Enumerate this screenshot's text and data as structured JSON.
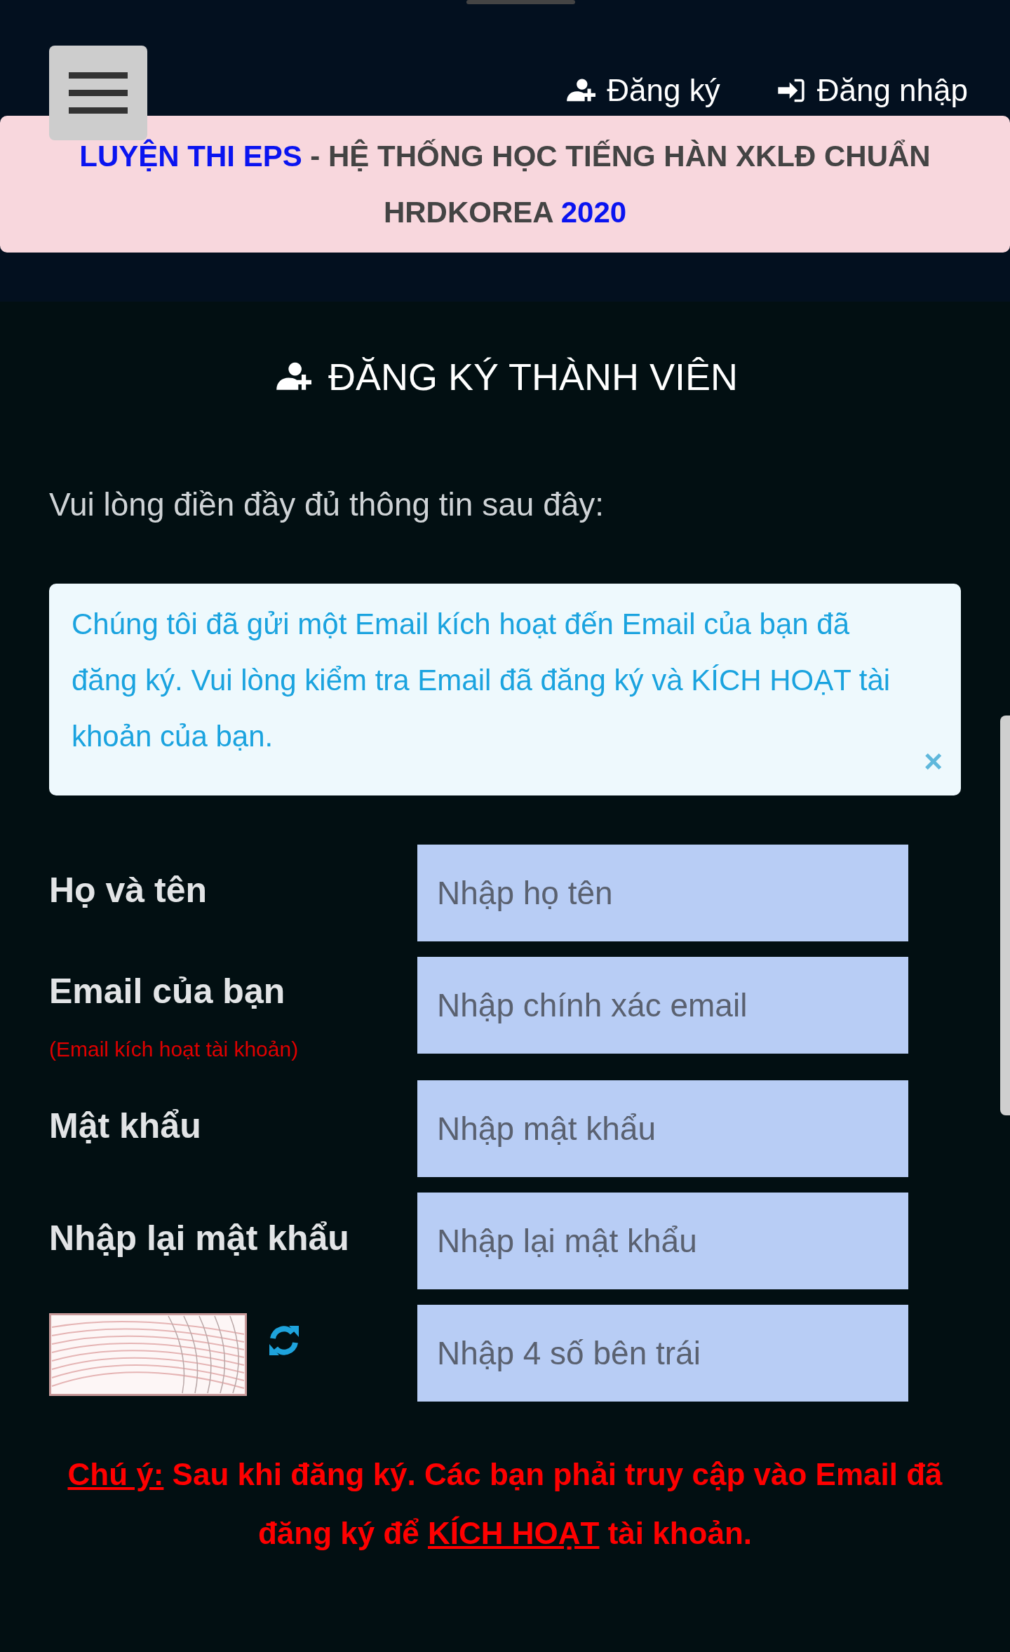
{
  "navbar": {
    "links": [
      {
        "label": "Đăng ký",
        "kind": "register"
      },
      {
        "label": "Đăng nhập",
        "kind": "login"
      }
    ]
  },
  "banner": {
    "parts": [
      {
        "text": "LUYỆN THI EPS",
        "highlight": true
      },
      {
        "text": " - HỆ THỐNG HỌC TIẾNG HÀN XKLĐ CHUẨN HRDKOREA ",
        "highlight": false
      },
      {
        "text": "2020",
        "highlight": true
      }
    ]
  },
  "form": {
    "title": "ĐĂNG KÝ THÀNH VIÊN",
    "subtitle": "Vui lòng điền đầy đủ thông tin sau đây:",
    "alert": {
      "text": "Chúng tôi đã gửi một Email kích hoạt đến Email của bạn đã đăng ký. Vui lòng kiểm tra Email đã đăng ký và KÍCH HOẠT tài khoản của bạn.",
      "close": "×"
    },
    "fields": [
      {
        "kind": "text",
        "label": "Họ và tên",
        "placeholder": "Nhập họ tên"
      },
      {
        "kind": "text",
        "label": "Email của bạn",
        "hint": "(Email kích hoạt tài khoản)",
        "placeholder": "Nhập chính xác email"
      },
      {
        "kind": "text",
        "label": "Mật khẩu",
        "placeholder": "Nhập mật khẩu"
      },
      {
        "kind": "text",
        "label": "Nhập lại mật khẩu",
        "placeholder": "Nhập lại mật khẩu"
      },
      {
        "kind": "captcha",
        "placeholder": "Nhập 4 số bên trái"
      }
    ],
    "note": {
      "parts": [
        {
          "text": "Chú ý:",
          "underline": true
        },
        {
          "text": " Sau khi đăng ký. Các bạn phải truy cập vào Email đã đăng ký để ",
          "underline": false
        },
        {
          "text": "KÍCH HOẠT",
          "underline": true
        },
        {
          "text": " tài khoản.",
          "underline": false
        }
      ]
    }
  }
}
